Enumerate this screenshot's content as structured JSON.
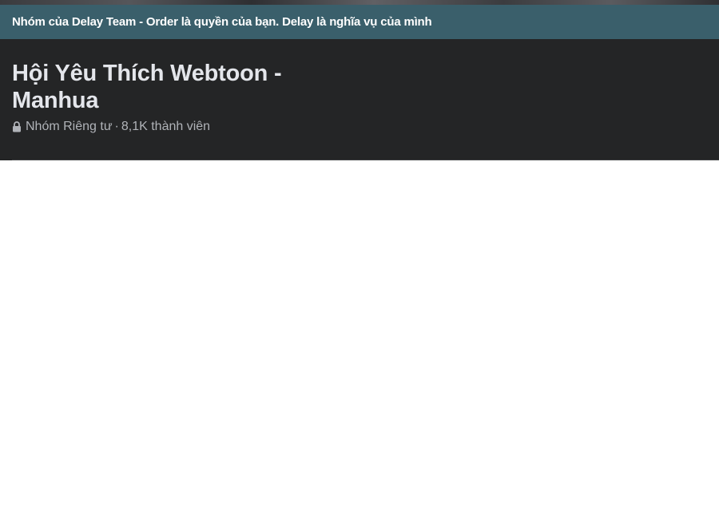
{
  "banner": {
    "text": "Nhóm của Delay Team - Order là quyền của bạn. Delay là nghĩa vụ của mình"
  },
  "group": {
    "title": "Hội Yêu Thích Webtoon - Manhua",
    "privacy": "Nhóm Riêng tư",
    "separator": "·",
    "members": "8,1K thành viên",
    "privacy_icon": "lock-icon"
  },
  "colors": {
    "banner_bg": "#3a5f6b",
    "header_bg": "#242526",
    "title_text": "#e4e6eb",
    "meta_text": "#b0b3b8",
    "page_bg": "#ffffff"
  }
}
